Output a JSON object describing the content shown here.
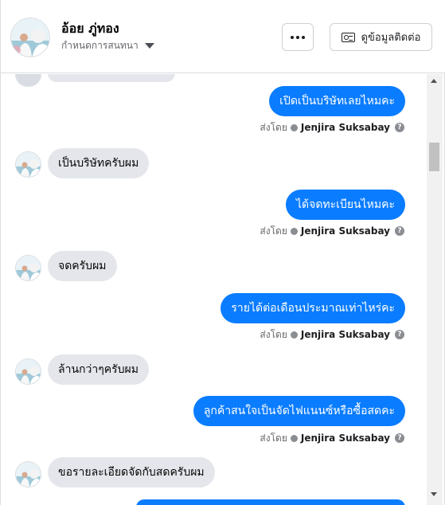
{
  "header": {
    "contact_name": "อ้อย ภู่ทอง",
    "status_label": "กำหนดการสนทนา",
    "contact_info_label": "ดูข้อมูลติดต่อ",
    "more_icon": "more-dots-icon",
    "contact_icon": "contact-card-icon"
  },
  "colors": {
    "outgoing_bubble": "#0a7cff",
    "incoming_bubble": "#e4e6eb",
    "secondary_text": "#65676b"
  },
  "sent_by_prefix": "ส่งโดย",
  "messages": [
    {
      "direction": "out",
      "text": "เปิดเป็นบริษัทเลยไหมคะ",
      "sender": "Jenjira Suksabay"
    },
    {
      "direction": "in",
      "text": "เป็นบริษัทครับผม"
    },
    {
      "direction": "out",
      "text": "ได้จดทะเบียนไหมคะ",
      "sender": "Jenjira Suksabay"
    },
    {
      "direction": "in",
      "text": "จดครับผม"
    },
    {
      "direction": "out",
      "text": "รายได้ต่อเดือนประมาณเท่าไหร่คะ",
      "sender": "Jenjira Suksabay"
    },
    {
      "direction": "in",
      "text": "ล้านกว่าๆครับผม"
    },
    {
      "direction": "out",
      "text": "ลูกค้าสนใจเป็นจัดไฟแนนซ์หรือซื้อสดคะ",
      "sender": "Jenjira Suksabay"
    },
    {
      "direction": "in",
      "text": "ขอรายละเอียดจัดกับสดครับผม"
    }
  ]
}
